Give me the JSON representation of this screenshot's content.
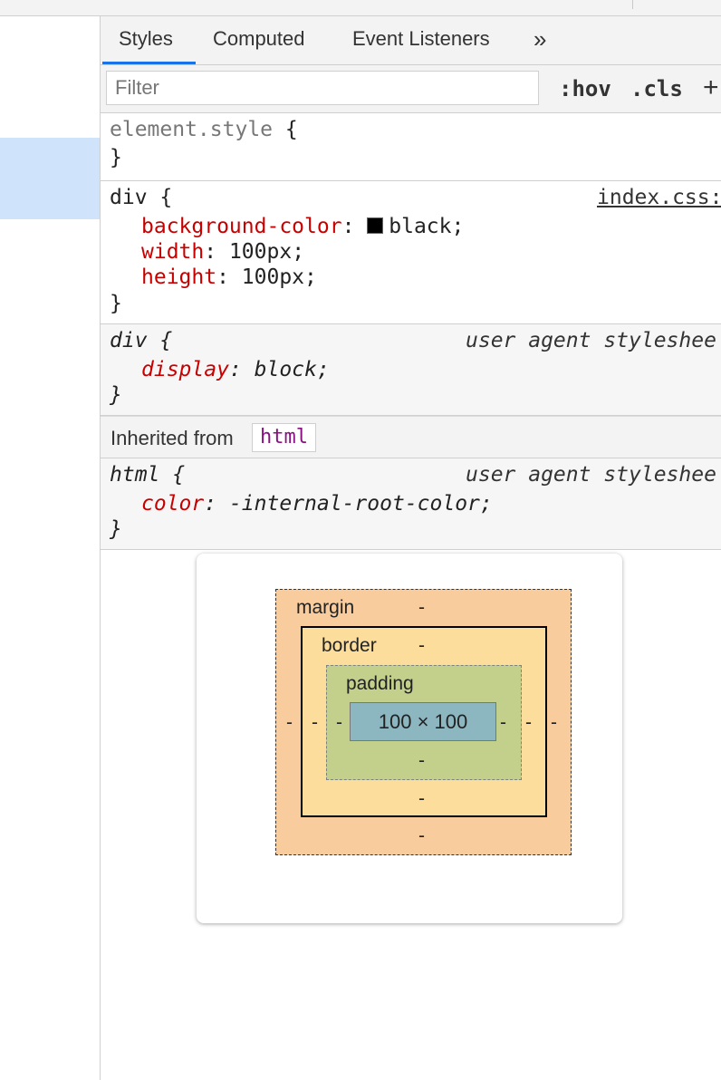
{
  "tabs": [
    {
      "label": "Styles",
      "selected": true
    },
    {
      "label": "Computed"
    },
    {
      "label": "Event Listeners"
    }
  ],
  "tabs_overflow": "»",
  "filter": {
    "placeholder": "Filter",
    "value": ""
  },
  "filter_buttons": {
    "hov": ":hov",
    "cls": ".cls",
    "plus": "+"
  },
  "rules": {
    "element_style": {
      "selector": "element.style",
      "open": "{",
      "close": "}"
    },
    "div": {
      "selector": "div",
      "open": "{",
      "source": "index.css:",
      "declarations": [
        {
          "property": "background-color",
          "value": "black",
          "swatch": "#000000"
        },
        {
          "property": "width",
          "value": "100px"
        },
        {
          "property": "height",
          "value": "100px"
        }
      ],
      "close": "}"
    },
    "ua_div": {
      "selector": "div",
      "open": "{",
      "source": "user agent styleshee",
      "declarations": [
        {
          "property": "display",
          "value": "block"
        }
      ],
      "close": "}"
    },
    "inherited": {
      "label": "Inherited from",
      "tag": "html"
    },
    "html": {
      "selector": "html",
      "open": "{",
      "source": "user agent styleshee",
      "declarations": [
        {
          "property": "color",
          "value": "-internal-root-color"
        }
      ],
      "close": "}"
    }
  },
  "box_model": {
    "margin_label": "margin",
    "border_label": "border",
    "padding_label": "padding",
    "content_size": "100 × 100",
    "dash": "-"
  },
  "colors": {
    "margin": "#f9cc9d",
    "border": "#fddd9b",
    "padding": "#c3d08b",
    "content": "#8cb6c0",
    "property": "#c80000",
    "tab_accent": "#1a73e8",
    "selected_node": "#cfe4fa"
  }
}
